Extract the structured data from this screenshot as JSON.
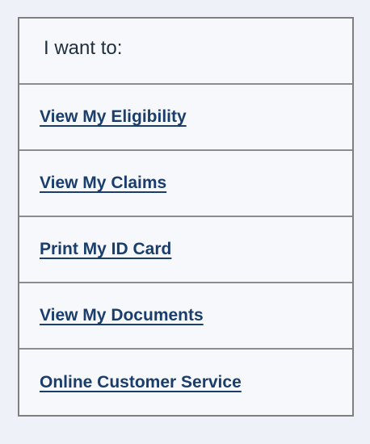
{
  "menu": {
    "header": "I want to:",
    "links": [
      "View My Eligibility",
      "View My Claims",
      "Print My ID Card",
      "View My Documents",
      "Online Customer Service"
    ]
  },
  "colors": {
    "page_background": "#eef2f8",
    "panel_background": "#f6f8fc",
    "border": "#7f7f7f",
    "link": "#1a3d6b",
    "header_text": "#1f2d3d"
  }
}
